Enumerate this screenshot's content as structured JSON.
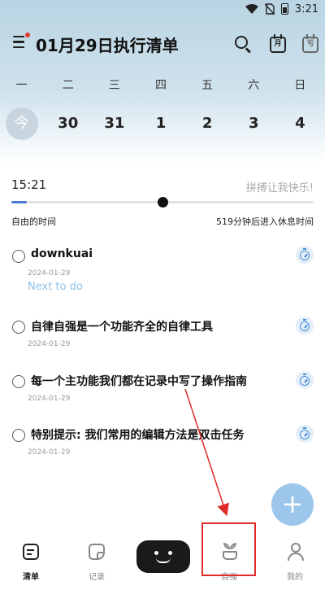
{
  "status_bar": {
    "time": "3:21",
    "icons": [
      "wifi-icon",
      "no-sim-icon",
      "battery-icon"
    ]
  },
  "header": {
    "title": "01月29日执行清单",
    "calendar_icon_text": "月",
    "calendar2_icon_text": "亏",
    "icons": [
      "menu-icon",
      "search-icon",
      "calendar-month-icon",
      "calendar-plan-icon"
    ]
  },
  "week": {
    "days": [
      "一",
      "二",
      "三",
      "四",
      "五",
      "六",
      "日"
    ],
    "dates": [
      "今",
      "30",
      "31",
      "1",
      "2",
      "3",
      "4"
    ]
  },
  "timeline": {
    "current_time": "15:21",
    "slogan": "拼搏让我快乐!",
    "free_time_label": "自由的时间",
    "rest_label": "519分钟后进入休息时间",
    "progress_fraction": 0.5
  },
  "tasks": [
    {
      "title": "downkuai",
      "date": "2024-01-29",
      "sub": "Next to do"
    },
    {
      "title": "自律自强是一个功能齐全的自律工具",
      "date": "2024-01-29"
    },
    {
      "title": "每一个主功能我们都在记录中写了操作指南",
      "date": "2024-01-29"
    },
    {
      "title": "特别提示: 我们常用的编辑方法是双击任务",
      "date": "2024-01-29"
    }
  ],
  "fab": {
    "label": "+"
  },
  "nav": {
    "items": [
      {
        "label": "清单",
        "active": true
      },
      {
        "label": "记录"
      },
      {
        "label": "自强"
      },
      {
        "label": "我的"
      }
    ]
  },
  "colors": {
    "accent": "#4a7ed6",
    "fab": "#9dc6ec",
    "annotation": "#e02a2a"
  }
}
